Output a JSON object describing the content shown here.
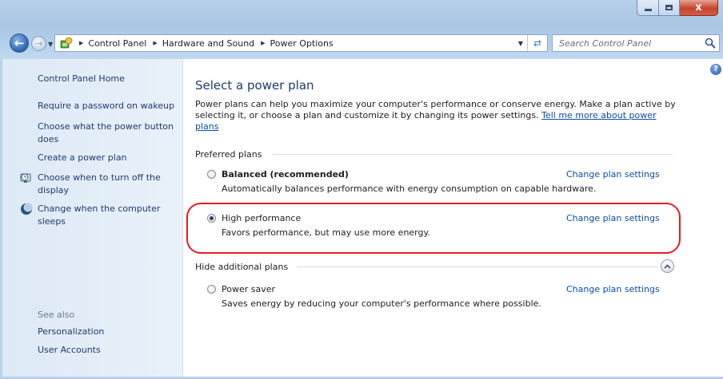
{
  "window": {
    "controls": {
      "minimize": "minimize",
      "maximize": "maximize",
      "close": "x"
    }
  },
  "address_bar": {
    "breadcrumbs": [
      "Control Panel",
      "Hardware and Sound",
      "Power Options"
    ]
  },
  "search": {
    "placeholder": "Search Control Panel"
  },
  "sidebar": {
    "home": "Control Panel Home",
    "links": [
      "Require a password on wakeup",
      "Choose what the power button does",
      "Create a power plan",
      "Choose when to turn off the display",
      "Change when the computer sleeps"
    ],
    "see_also_label": "See also",
    "see_also": [
      "Personalization",
      "User Accounts"
    ]
  },
  "main": {
    "title": "Select a power plan",
    "intro": "Power plans can help you maximize your computer's performance or conserve energy. Make a plan active by selecting it, or choose a plan and customize it by changing its power settings.",
    "intro_link": "Tell me more about power plans",
    "preferred_header": "Preferred plans",
    "additional_header": "Hide additional plans",
    "plans": [
      {
        "name": "Balanced (recommended)",
        "description": "Automatically balances performance with energy consumption on capable hardware.",
        "change": "Change plan settings",
        "selected": false
      },
      {
        "name": "High performance",
        "description": "Favors performance, but may use more energy.",
        "change": "Change plan settings",
        "selected": true
      },
      {
        "name": "Power saver",
        "description": "Saves energy by reducing your computer's performance where possible.",
        "change": "Change plan settings",
        "selected": false
      }
    ]
  },
  "colors": {
    "link": "#0b4ea2",
    "title": "#1e3a6b",
    "highlight": "#e21c24",
    "sidebar_bg": "#dde9f6"
  }
}
